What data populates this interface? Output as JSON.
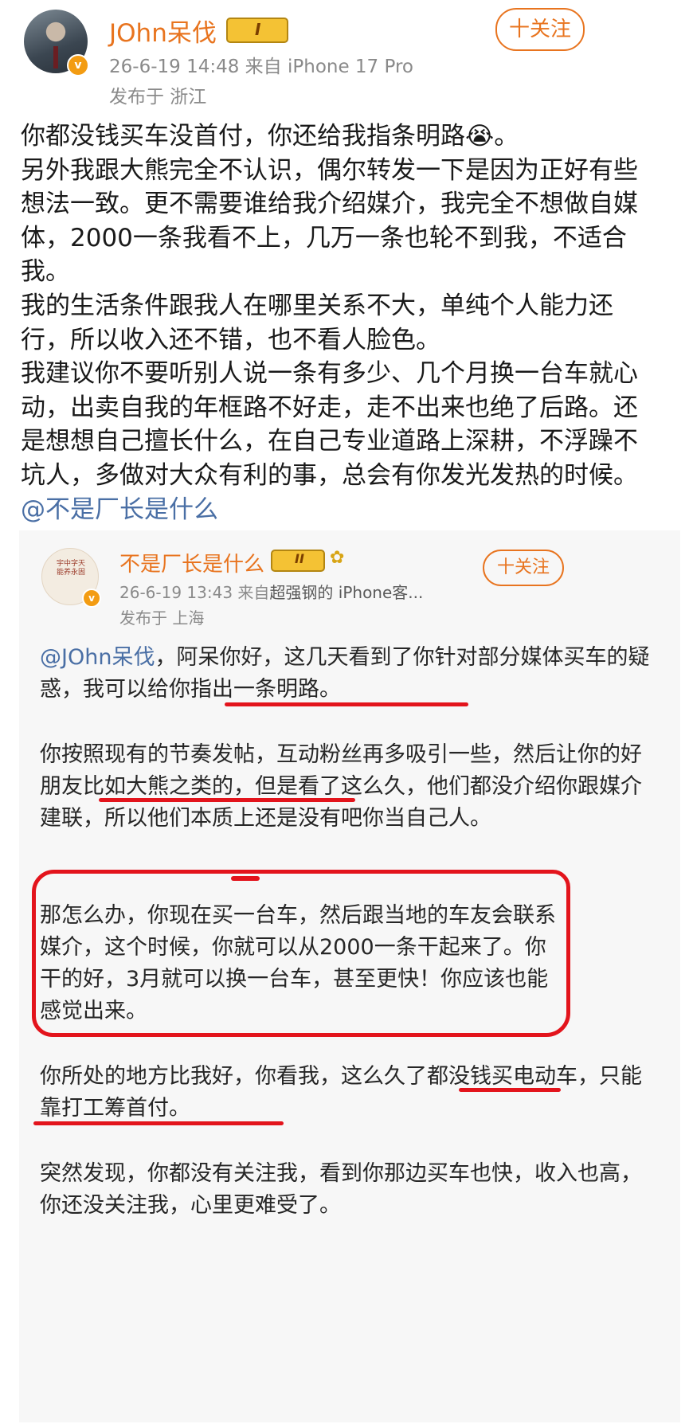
{
  "post": {
    "author": "JOhn呆伐",
    "level_badge": "I",
    "meta": "26-6-19 14:48   来自 iPhone 17 Pro",
    "location": "发布于 浙江",
    "follow_label": "十关注",
    "paragraphs": [
      "你都没钱买车没首付，你还给我指条明路😭。",
      "另外我跟大熊完全不认识，偶尔转发一下是因为正好有些想法一致。更不需要谁给我介绍媒介，我完全不想做自媒体，2000一条我看不上，几万一条也轮不到我，不适合我。",
      "我的生活条件跟我人在哪里关系不大，单纯个人能力还行，所以收入还不错，也不看人脸色。",
      "我建议你不要听别人说一条有多少、几个月换一台车就心动，出卖自我的年框路不好走，走不出来也绝了后路。还是想想自己擅长什么，在自己专业道路上深耕，不浮躁不坑人，多做对大众有利的事，总会有你发光发热的时候。"
    ],
    "mention": "@不是厂长是什么"
  },
  "quoted": {
    "author": "不是厂长是什么",
    "level_badge": "II",
    "meta_prefix": "26-6-19 13:43   来自",
    "meta_source": "超强钢的 iPhone客...",
    "location": "发布于 上海",
    "follow_label": "十关注",
    "avatar_seal": "宇中字天 能养永固",
    "p1_mention": "@JOhn呆伐",
    "p1_text": "，阿呆你好，这几天看到了你针对部分媒体买车的疑惑，我可以给你指出一条明路。",
    "p2": "你按照现有的节奏发帖，互动粉丝再多吸引一些，然后让你的好朋友比如大熊之类的，但是看了这么久，他们都没介绍你跟媒介建联，所以他们本质上还是没有吧你当自己人。",
    "p3": "那怎么办，你现在买一台车，然后跟当地的车友会联系媒介，这个时候，你就可以从2000一条干起来了。你干的好，3月就可以换一台车，甚至更快！你应该也能感觉出来。",
    "p4": "你所处的地方比我好，你看我，这么久了都没钱买电动车，只能靠打工筹首付。",
    "p5": "突然发现，你都没有关注我，看到你那边买车也快，收入也高，你还没关注我，心里更难受了。"
  },
  "colors": {
    "accent": "#e8741f",
    "mention": "#4a6fa5",
    "annotation_red": "#e3141c"
  }
}
